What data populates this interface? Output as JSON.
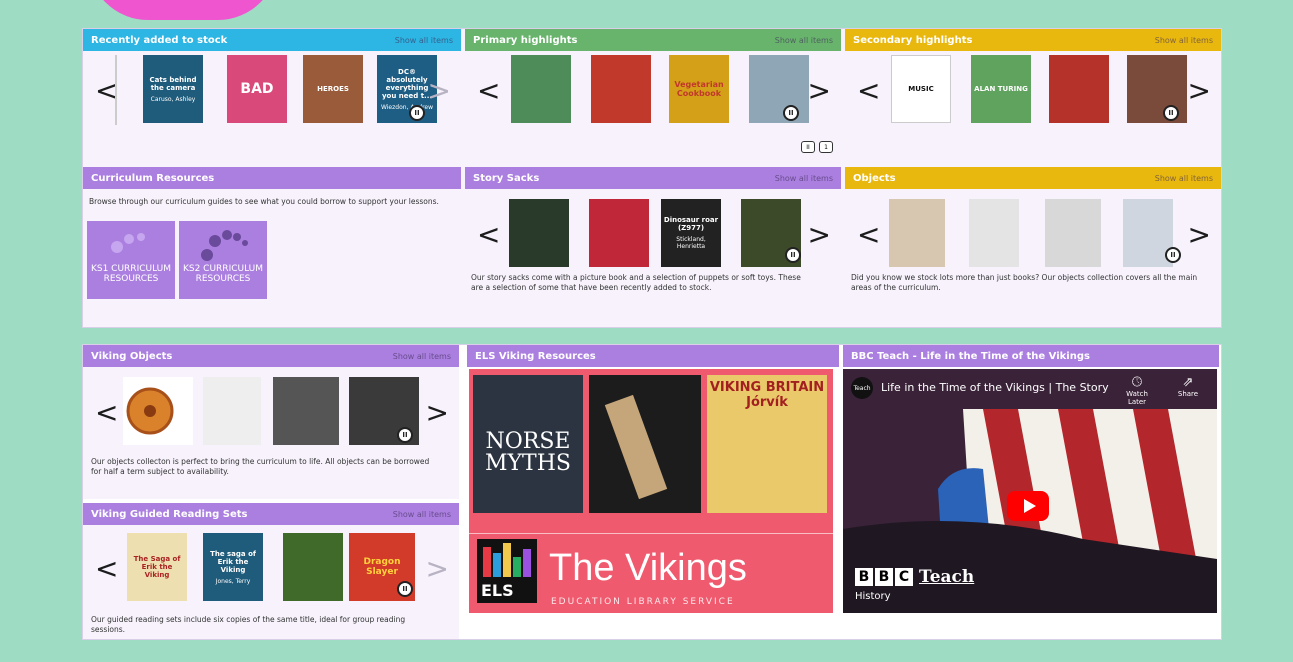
{
  "panels": {
    "recent": {
      "title": "Recently added to stock",
      "show_all": "Show all items",
      "items": [
        {
          "text": "Cats behind the camera",
          "author": "Caruso, Ashley"
        },
        {
          "text": "BAD",
          "author": ""
        },
        {
          "text": "HEROES",
          "author": ""
        },
        {
          "text": "DC® absolutely everything you need t...",
          "author": "Wiezdon, Andrew"
        }
      ]
    },
    "primary": {
      "title": "Primary highlights",
      "show_all": "Show all items",
      "items": [
        {
          "text": "",
          "author": ""
        },
        {
          "text": "",
          "author": ""
        },
        {
          "text": "Vegetarian Cookbook",
          "author": ""
        },
        {
          "text": "",
          "author": ""
        }
      ]
    },
    "secondary": {
      "title": "Secondary highlights",
      "show_all": "Show all items",
      "items": [
        {
          "text": "MUSIC",
          "author": ""
        },
        {
          "text": "ALAN TURING",
          "author": ""
        },
        {
          "text": "",
          "author": ""
        },
        {
          "text": "",
          "author": ""
        }
      ]
    },
    "curriculum": {
      "title": "Curriculum Resources",
      "description": "Browse through our curriculum guides to see what you could borrow to support your lessons.",
      "tiles": [
        {
          "label": "KS1 CURRICULUM RESOURCES"
        },
        {
          "label": "KS2 CURRICULUM RESOURCES"
        }
      ]
    },
    "story_sacks": {
      "title": "Story Sacks",
      "show_all": "Show all items",
      "description": "Our story sacks come with a picture book and a selection of puppets or soft toys. These are a selection of some that have been recently added to stock.",
      "items": [
        {
          "text": "",
          "author": ""
        },
        {
          "text": "",
          "author": ""
        },
        {
          "text": "Dinosaur roar (Z977)",
          "author": "Stickland, Henrietta"
        },
        {
          "text": "",
          "author": ""
        }
      ]
    },
    "objects": {
      "title": "Objects",
      "show_all": "Show all items",
      "description": "Did you know we stock lots more than just books? Our objects collection covers all the main areas of the curriculum."
    },
    "viking_objects": {
      "title": "Viking Objects",
      "show_all": "Show all items",
      "description": "Our objects collecton is perfect to bring the curriculum to life. All objects can be borrowed for half a term subject to availability."
    },
    "viking_reading": {
      "title": "Viking Guided Reading Sets",
      "show_all": "Show all items",
      "description": "Our guided reading sets include six copies of the same title, ideal for group reading sessions.",
      "items": [
        {
          "text": "The Saga of Erik the Viking",
          "author": ""
        },
        {
          "text": "The saga of Erik the Viking",
          "author": "Jones, Terry"
        },
        {
          "text": "",
          "author": ""
        },
        {
          "text": "Dragon Slayer",
          "author": ""
        }
      ]
    },
    "els_viking": {
      "title": "ELS Viking Resources",
      "book1": "NORSE MYTHS",
      "book3": "VIKING BRITAIN Jórvík",
      "banner_title": "The Vikings",
      "banner_logo": "ELS",
      "banner_sub": "EDUCATION LIBRARY SERVICE"
    },
    "bbc": {
      "title": "BBC Teach - Life in the Time of the Vikings",
      "video_title": "Life in the Time of the Vikings | The Story of...",
      "channel": "Teach",
      "watch_later": "Watch Later",
      "share": "Share",
      "brand": "Teach",
      "brand_sub": "History"
    }
  },
  "controls": {
    "prev": "<",
    "next": ">",
    "pause": "II",
    "page": "1"
  },
  "colors": {
    "background": "#9edcc3",
    "blue": "#2db5e3",
    "green": "#69b46d",
    "yellow": "#e9b80f",
    "purple": "#ab7fe0",
    "pink": "#ee55cf",
    "els_red": "#f05a6e"
  }
}
